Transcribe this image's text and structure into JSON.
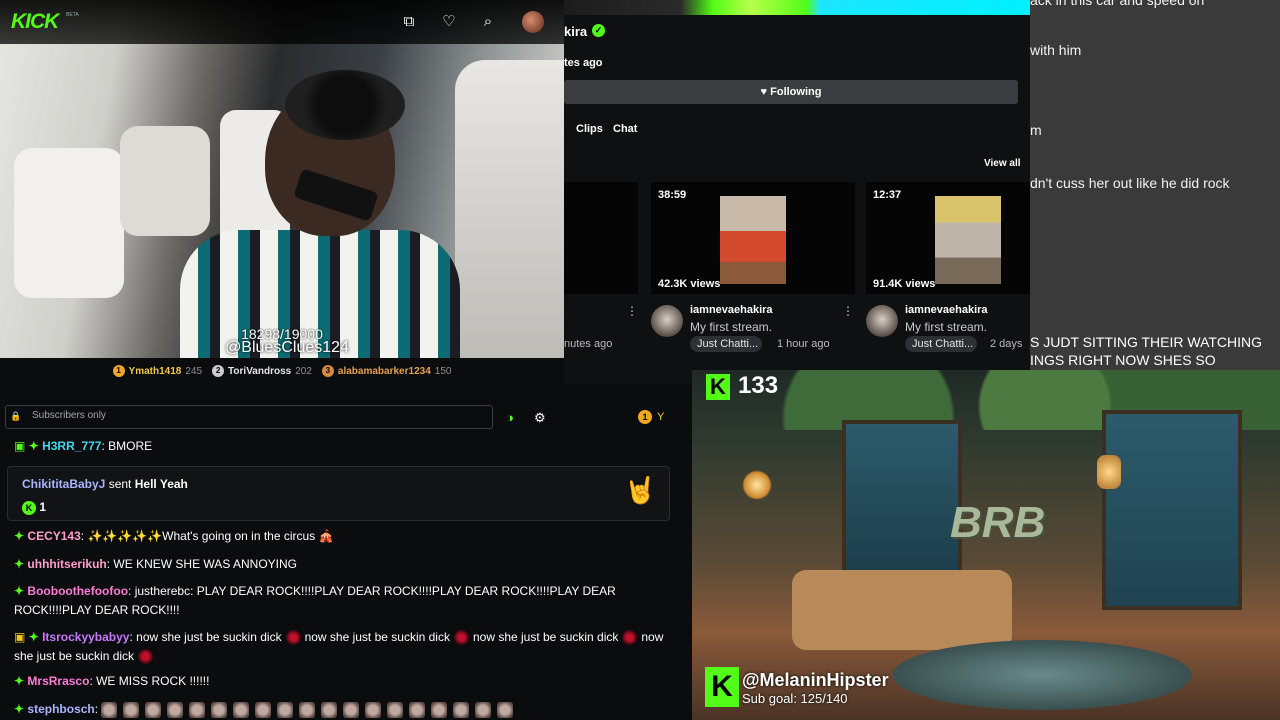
{
  "colors": {
    "kick_green": "#53fc18",
    "panel_bg": "#0b0c0e",
    "gold": "#f0a81c"
  },
  "topbar": {
    "logo": "KICK",
    "logo_badge": "BETA",
    "icons": [
      "clips-icon",
      "heart-icon",
      "search-icon",
      "avatar"
    ]
  },
  "video": {
    "counter": "18298/19000",
    "watermark": "@BluesClues124"
  },
  "gifters": [
    {
      "name": "Ymath1418",
      "count": "245",
      "badge": "gold"
    },
    {
      "name": "ToriVandross",
      "count": "202",
      "badge": "silver"
    },
    {
      "name": "alabamabarker1234",
      "count": "150",
      "badge": "bronze"
    }
  ],
  "channel": {
    "name": "kira",
    "live_ago": "tes ago",
    "follow_label": "Following",
    "tabs": [
      "Clips",
      "Chat"
    ],
    "view_all": "View all",
    "videos": [
      {
        "user": "",
        "title": "",
        "tag": "",
        "time": "nutes ago",
        "duration": "",
        "views": ""
      },
      {
        "user": "iamnevaehakira",
        "title": "My first stream.",
        "tag": "Just Chatti...",
        "time": "1 hour ago",
        "duration": "38:59",
        "views": "42.3K views"
      },
      {
        "user": "iamnevaehakira",
        "title": "My first stream.",
        "tag": "Just Chatti...",
        "time": "2 days",
        "duration": "12:37",
        "views": "91.4K views"
      }
    ]
  },
  "bg_chat": {
    "lines": [
      "ack in this car and speed on",
      "with him",
      "m",
      "dn't cuss her out like he did rock"
    ],
    "caption": [
      "S JUDT SITTING THEIR WATCHING",
      "INGS RIGHT NOW SHES SO"
    ]
  },
  "chat": {
    "input_placeholder": "Subscribers only",
    "right_label": "Y",
    "messages": [
      {
        "user": "H3RR_777",
        "color": "#3fd9e8",
        "text": "BMORE"
      },
      {
        "user": "CECY143",
        "color": "#ff9ecf",
        "text": "✨✨✨✨✨What's going on in the circus 🎪"
      },
      {
        "user": "uhhhitserikuh",
        "color": "#ff9ecf",
        "text": "WE KNEW SHE WAS ANNOYING"
      },
      {
        "user": "Booboothefoofoo",
        "color": "#ff7ad9",
        "text": "justherebc: PLAY DEAR ROCK!!!!PLAY DEAR ROCK!!!!PLAY DEAR ROCK!!!!PLAY DEAR ROCK!!!!PLAY DEAR ROCK!!!!"
      },
      {
        "user": "Itsrockyybabyy",
        "color": "#c678ff",
        "segments": [
          "now she just be suckin dick",
          "now she just be suckin dick",
          "now she just be suckin dick",
          "now she just be suckin dick"
        ]
      },
      {
        "user": "MrsRrasco",
        "color": "#ff7ad9",
        "text": "WE MISS ROCK !!!!!!"
      },
      {
        "user": "stephbosch",
        "color": "#a8b6ff",
        "text": ""
      }
    ],
    "gift": {
      "sender": "ChikititaBabyJ",
      "verb": "sent",
      "item": "Hell Yeah",
      "count": "1"
    }
  },
  "overlay": {
    "kick_count": "133",
    "handle": "@MelaninHipster",
    "sub_goal": "Sub goal: 125/140",
    "brb": "BRB"
  }
}
